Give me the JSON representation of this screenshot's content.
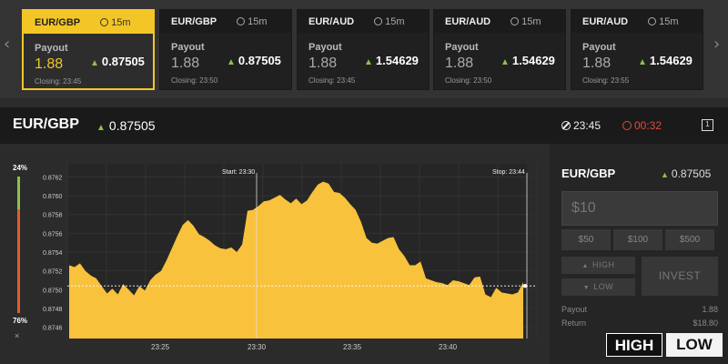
{
  "carousel": {
    "cards": [
      {
        "pair": "EUR/GBP",
        "duration": "15m",
        "payout_label": "Payout",
        "payout": "1.88",
        "rate": "0.87505",
        "closing": "Closing: 23:45",
        "active": true
      },
      {
        "pair": "EUR/GBP",
        "duration": "15m",
        "payout_label": "Payout",
        "payout": "1.88",
        "rate": "0.87505",
        "closing": "Closing: 23:50",
        "active": false
      },
      {
        "pair": "EUR/AUD",
        "duration": "15m",
        "payout_label": "Payout",
        "payout": "1.88",
        "rate": "1.54629",
        "closing": "Closing: 23:45",
        "active": false
      },
      {
        "pair": "EUR/AUD",
        "duration": "15m",
        "payout_label": "Payout",
        "payout": "1.88",
        "rate": "1.54629",
        "closing": "Closing: 23:50",
        "active": false
      },
      {
        "pair": "EUR/AUD",
        "duration": "15m",
        "payout_label": "Payout",
        "payout": "1.88",
        "rate": "1.54629",
        "closing": "Closing: 23:55",
        "active": false
      }
    ],
    "prev_icon": "chevron-left-icon",
    "next_icon": "chevron-right-icon"
  },
  "instrument": {
    "pair": "EUR/GBP",
    "price": "0.87505",
    "closing_time": "23:45",
    "countdown": "00:32",
    "colors": {
      "up": "#8bc34a",
      "countdown": "#e04c3c",
      "accent": "#f3c626"
    }
  },
  "sentiment": {
    "top": "24%",
    "bottom": "76%",
    "close": "×",
    "up_fraction": 0.24
  },
  "chart_data": {
    "type": "area",
    "x_ticks": [
      "23:25",
      "23:30",
      "23:35",
      "23:40"
    ],
    "y_ticks": [
      "0.8762",
      "0.8760",
      "0.8758",
      "0.8756",
      "0.8754",
      "0.8752",
      "0.8750",
      "0.8748",
      "0.8746"
    ],
    "ylim": [
      0.87448,
      0.87634
    ],
    "xlim": [
      23.3778,
      23.5
    ],
    "start_label": "Start: 23:30",
    "stop_label": "Stop: 23:44",
    "strike": 0.87504,
    "fill_color": "#f9c23c",
    "series": [
      {
        "values": [
          0.87526,
          0.87524,
          0.87528,
          0.8752,
          0.87515,
          0.87512,
          0.87504,
          0.87496,
          0.87501,
          0.87495,
          0.87506,
          0.875,
          0.87494,
          0.87504,
          0.87499,
          0.8751,
          0.87516,
          0.8752,
          0.87531,
          0.87544,
          0.87557,
          0.87569,
          0.87574,
          0.87568,
          0.87559,
          0.87556,
          0.87552,
          0.87547,
          0.87544,
          0.87543,
          0.87545,
          0.8754,
          0.87548,
          0.87584,
          0.87585,
          0.87589,
          0.87594,
          0.87595,
          0.87598,
          0.87601,
          0.87596,
          0.87592,
          0.87597,
          0.87591,
          0.87595,
          0.87604,
          0.87612,
          0.87615,
          0.87613,
          0.87604,
          0.87603,
          0.87598,
          0.87591,
          0.87585,
          0.87572,
          0.87555,
          0.8755,
          0.87549,
          0.87552,
          0.87555,
          0.87556,
          0.87543,
          0.87536,
          0.87526,
          0.87526,
          0.8753,
          0.87512,
          0.8751,
          0.87508,
          0.87507,
          0.87505,
          0.8751,
          0.87509,
          0.87507,
          0.87505,
          0.87513,
          0.87514,
          0.87495,
          0.87492,
          0.87502,
          0.87497,
          0.87496,
          0.87495,
          0.87497,
          0.87508
        ]
      }
    ]
  },
  "trade": {
    "pair": "EUR/GBP",
    "price": "0.87505",
    "amount_placeholder": "$10",
    "quick_amounts": [
      "$50",
      "$100",
      "$500"
    ],
    "high_label": "HIGH",
    "low_label": "LOW",
    "invest_label": "INVEST",
    "payout_label": "Payout",
    "payout_value": "1.88",
    "return_label": "Return",
    "return_value": "$18.80"
  },
  "logo": {
    "left": "HIGH",
    "right": "LOW"
  }
}
